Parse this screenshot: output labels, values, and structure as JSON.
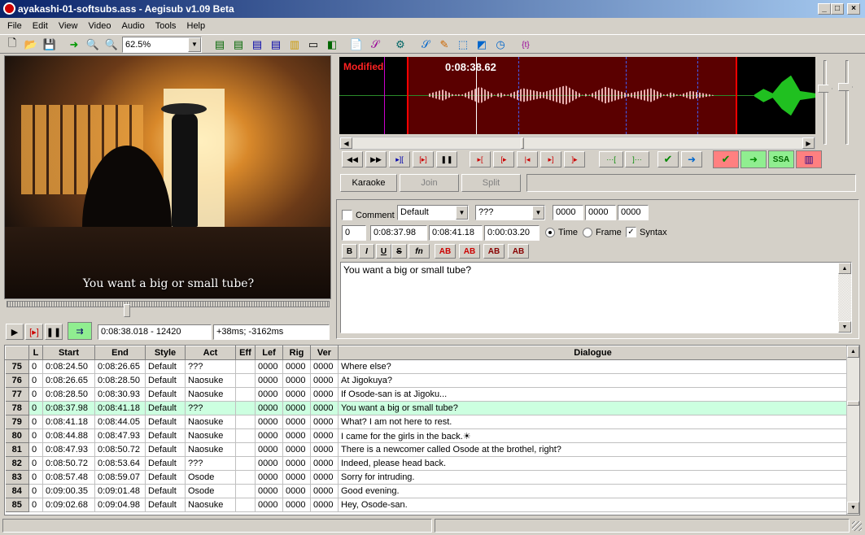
{
  "window": {
    "title": "ayakashi-01-softsubs.ass - Aegisub v1.09 Beta",
    "min": "_",
    "max": "□",
    "close": "×"
  },
  "menu": [
    "File",
    "Edit",
    "View",
    "Video",
    "Audio",
    "Tools",
    "Help"
  ],
  "toolbar": {
    "zoom": "62.5%"
  },
  "video": {
    "subtitle": "You want a big or small tube?",
    "time": "0:08:38.018 - 12420",
    "offset": "+38ms; -3162ms"
  },
  "audio": {
    "modified": "Modified",
    "time": "0:08:38.62",
    "karaoke": "Karaoke",
    "join": "Join",
    "split": "Split",
    "ssa": "SSA"
  },
  "editor": {
    "comment_label": "Comment",
    "style": "Default",
    "actor": "???",
    "margin_l": "0000",
    "margin_r": "0000",
    "margin_v": "0000",
    "layer": "0",
    "start": "0:08:37.98",
    "end": "0:08:41.18",
    "duration": "0:00:03.20",
    "time_label": "Time",
    "frame_label": "Frame",
    "syntax_label": "Syntax",
    "text": "You want a big or small tube?",
    "fmt": [
      "B",
      "I",
      "U",
      "S",
      "fn",
      "AB",
      "AB",
      "AB",
      "AB"
    ]
  },
  "grid": {
    "headers": [
      "",
      "L",
      "Start",
      "End",
      "Style",
      "Act",
      "Eff",
      "Lef",
      "Rig",
      "Ver",
      "Dialogue"
    ],
    "rows": [
      [
        "75",
        "0",
        "0:08:24.50",
        "0:08:26.65",
        "Default",
        "???",
        "",
        "0000",
        "0000",
        "0000",
        "Where else?"
      ],
      [
        "76",
        "0",
        "0:08:26.65",
        "0:08:28.50",
        "Default",
        "Naosuke",
        "",
        "0000",
        "0000",
        "0000",
        "At Jigokuya?"
      ],
      [
        "77",
        "0",
        "0:08:28.50",
        "0:08:30.93",
        "Default",
        "Naosuke",
        "",
        "0000",
        "0000",
        "0000",
        "If Osode-san is at Jigoku..."
      ],
      [
        "78",
        "0",
        "0:08:37.98",
        "0:08:41.18",
        "Default",
        "???",
        "",
        "0000",
        "0000",
        "0000",
        "You want a big or small tube?"
      ],
      [
        "79",
        "0",
        "0:08:41.18",
        "0:08:44.05",
        "Default",
        "Naosuke",
        "",
        "0000",
        "0000",
        "0000",
        "What? I am not here to rest."
      ],
      [
        "80",
        "0",
        "0:08:44.88",
        "0:08:47.93",
        "Default",
        "Naosuke",
        "",
        "0000",
        "0000",
        "0000",
        "I came for the girls in the back.☀"
      ],
      [
        "81",
        "0",
        "0:08:47.93",
        "0:08:50.72",
        "Default",
        "Naosuke",
        "",
        "0000",
        "0000",
        "0000",
        "There is a newcomer called Osode at the brothel, right?"
      ],
      [
        "82",
        "0",
        "0:08:50.72",
        "0:08:53.64",
        "Default",
        "???",
        "",
        "0000",
        "0000",
        "0000",
        "Indeed, please head back."
      ],
      [
        "83",
        "0",
        "0:08:57.48",
        "0:08:59.07",
        "Default",
        "Osode",
        "",
        "0000",
        "0000",
        "0000",
        "Sorry for intruding."
      ],
      [
        "84",
        "0",
        "0:09:00.35",
        "0:09:01.48",
        "Default",
        "Osode",
        "",
        "0000",
        "0000",
        "0000",
        "Good evening."
      ],
      [
        "85",
        "0",
        "0:09:02.68",
        "0:09:04.98",
        "Default",
        "Naosuke",
        "",
        "0000",
        "0000",
        "0000",
        "Hey, Osode-san."
      ]
    ]
  }
}
